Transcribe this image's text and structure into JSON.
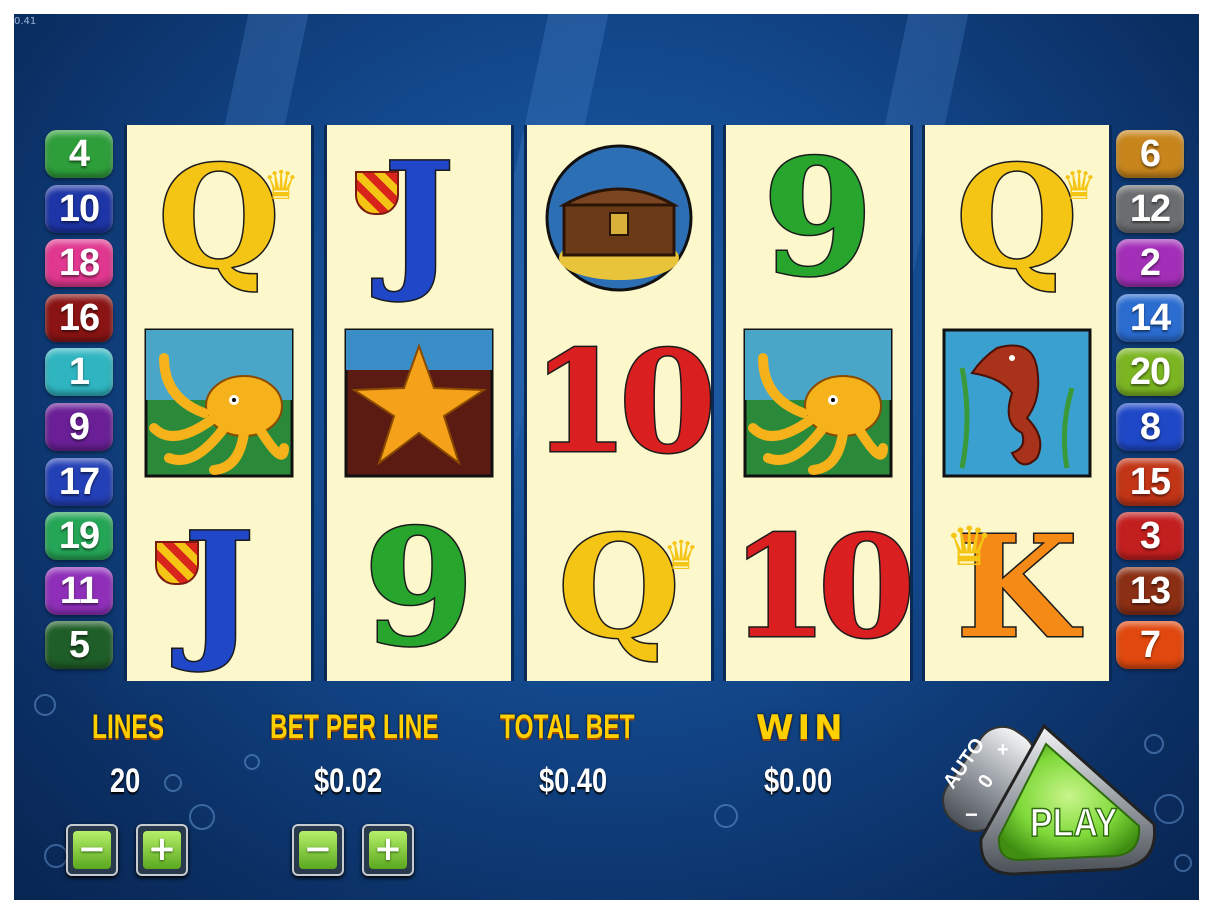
{
  "version": "0.41",
  "paylines": {
    "left": [
      {
        "n": "4",
        "color": "#2e9e3a"
      },
      {
        "n": "10",
        "color": "#1d35a6"
      },
      {
        "n": "18",
        "color": "#e0378f"
      },
      {
        "n": "16",
        "color": "#8a1414"
      },
      {
        "n": "1",
        "color": "#2fb5c0"
      },
      {
        "n": "9",
        "color": "#6a1f96"
      },
      {
        "n": "17",
        "color": "#2340b6"
      },
      {
        "n": "19",
        "color": "#25a556"
      },
      {
        "n": "11",
        "color": "#8f2fb9"
      },
      {
        "n": "5",
        "color": "#1f5e28"
      }
    ],
    "right": [
      {
        "n": "6",
        "color": "#c7851c"
      },
      {
        "n": "12",
        "color": "#6b6e70"
      },
      {
        "n": "2",
        "color": "#a32fb8"
      },
      {
        "n": "14",
        "color": "#2a6cd0"
      },
      {
        "n": "20",
        "color": "#7bb522"
      },
      {
        "n": "8",
        "color": "#1f48c6"
      },
      {
        "n": "15",
        "color": "#c23517"
      },
      {
        "n": "3",
        "color": "#c21f1f"
      },
      {
        "n": "13",
        "color": "#8a2e14"
      },
      {
        "n": "7",
        "color": "#e0480f"
      }
    ]
  },
  "reels": [
    [
      {
        "symbol": "queen"
      },
      {
        "symbol": "octopus"
      },
      {
        "symbol": "jack"
      }
    ],
    [
      {
        "symbol": "jack"
      },
      {
        "symbol": "starfish"
      },
      {
        "symbol": "nine"
      }
    ],
    [
      {
        "symbol": "treasure-chest"
      },
      {
        "symbol": "ten"
      },
      {
        "symbol": "queen"
      }
    ],
    [
      {
        "symbol": "nine"
      },
      {
        "symbol": "octopus"
      },
      {
        "symbol": "ten"
      }
    ],
    [
      {
        "symbol": "queen"
      },
      {
        "symbol": "seahorse"
      },
      {
        "symbol": "king"
      }
    ]
  ],
  "symbol_text": {
    "queen": "Q",
    "jack": "J",
    "nine": "9",
    "ten": "10",
    "king": "K"
  },
  "controls": {
    "lines_label": "LINES",
    "lines_value": "20",
    "bet_label": "BET PER LINE",
    "bet_value": "$0.02",
    "total_label": "TOTAL BET",
    "total_value": "$0.40",
    "win_label": "WIN",
    "win_value": "$0.00",
    "minus": "−",
    "plus": "+",
    "auto_label": "AUTO",
    "auto_count": "0",
    "auto_plus": "+",
    "auto_minus": "−",
    "play_label": "PLAY"
  },
  "colors": {
    "label_gold": "#ffd000",
    "play_green": "#7fd93a",
    "reel_bg": "#fdf8cc"
  }
}
